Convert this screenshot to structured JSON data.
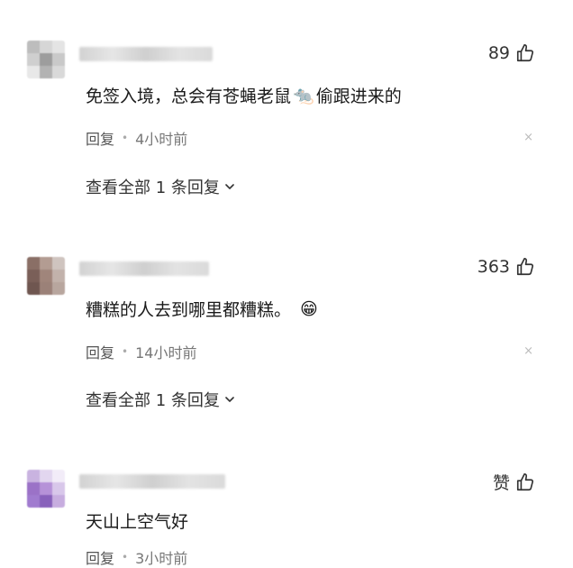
{
  "comments": [
    {
      "avatar_colors": [
        "#bdbdbd",
        "#d6d6d6",
        "#e4e4e4",
        "#cfcfcf",
        "#9d9d9d",
        "#c9c9c9",
        "#e8e8e8",
        "#b3b3b3",
        "#d9d9d9"
      ],
      "likes": "89",
      "text_before": "免签入境，总会有苍蝇老鼠",
      "emoji": "🐀",
      "text_after": "偷跟进来的",
      "reply_label": "回复",
      "time": "4小时前",
      "close": "×",
      "view_all": "查看全部 1 条回复"
    },
    {
      "avatar_colors": [
        "#8a6f66",
        "#b39c92",
        "#cfc4bf",
        "#7a5f58",
        "#a0857b",
        "#c2b2ab",
        "#6f5650",
        "#9b8178",
        "#b8a69e"
      ],
      "likes": "363",
      "text_before": "糟糕的人去到哪里都糟糕。",
      "emoji": "😁",
      "text_after": "",
      "reply_label": "回复",
      "time": "14小时前",
      "close": "×",
      "view_all": "查看全部 1 条回复"
    },
    {
      "avatar_colors": [
        "#c9b3e0",
        "#e2d6ef",
        "#f2ecf8",
        "#9b72c7",
        "#b692d8",
        "#d8c7ea",
        "#a07bcf",
        "#8861bb",
        "#c7addf"
      ],
      "likes": "赞",
      "text_before": "天山上空气好",
      "emoji": "",
      "text_after": "",
      "reply_label": "回复",
      "time": "3小时前"
    }
  ]
}
